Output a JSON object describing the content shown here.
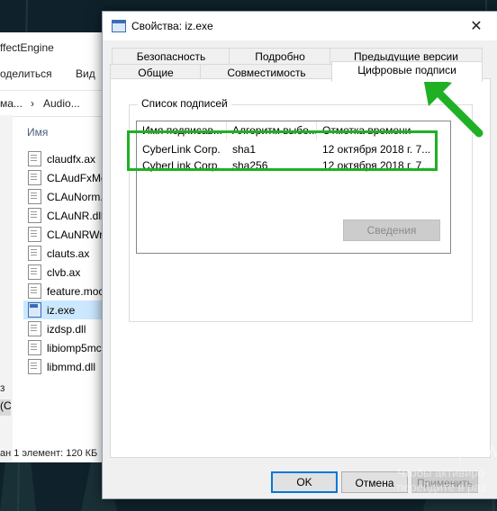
{
  "explorer": {
    "title": "ffectEngine",
    "ribbon": {
      "share": "оделиться",
      "view": "Вид"
    },
    "address": {
      "path": "ма...",
      "folder": "Audio..."
    },
    "column_name": "Имя",
    "files": [
      {
        "name": "claudfx.ax"
      },
      {
        "name": "CLAudFxMg"
      },
      {
        "name": "CLAuNorm."
      },
      {
        "name": "CLAuNR.dll"
      },
      {
        "name": "CLAuNRWra"
      },
      {
        "name": "clauts.ax"
      },
      {
        "name": "clvb.ax"
      },
      {
        "name": "feature.moc"
      },
      {
        "name": "iz.exe"
      },
      {
        "name": "izdsp.dll"
      },
      {
        "name": "libiomp5mc"
      },
      {
        "name": "libmmd.dll"
      }
    ],
    "side_labels": [
      "з",
      "(C"
    ],
    "status": "ан 1 элемент: 120 КБ"
  },
  "dialog": {
    "title": "Свойства: iz.exe",
    "close_glyph": "✕",
    "tabs_row1": [
      "Безопасность",
      "Подробно",
      "Предыдущие версии"
    ],
    "tabs_row2": [
      "Общие",
      "Совместимость",
      "Цифровые подписи"
    ],
    "group_label": "Список подписей",
    "columns": [
      "Имя подписав...",
      "Алгоритм выбо...",
      "Отметка времени"
    ],
    "signatures": [
      {
        "signer": "CyberLink Corp.",
        "algorithm": "sha1",
        "timestamp": "12 октября 2018 г. 7..."
      },
      {
        "signer": "CyberLink Corp.",
        "algorithm": "sha256",
        "timestamp": "12 октября 2018 г. 7..."
      }
    ],
    "details_button": "Сведения",
    "ok_button": "OK",
    "cancel_button": "Отмена",
    "apply_button": "Применить"
  },
  "watermark": {
    "title": "Активация W",
    "line1": "Чтобы активиро",
    "line2": "перейдите в раз"
  },
  "colors": {
    "highlight": "#1fb024",
    "selection": "#cce8ff",
    "accent": "#0078d7"
  }
}
